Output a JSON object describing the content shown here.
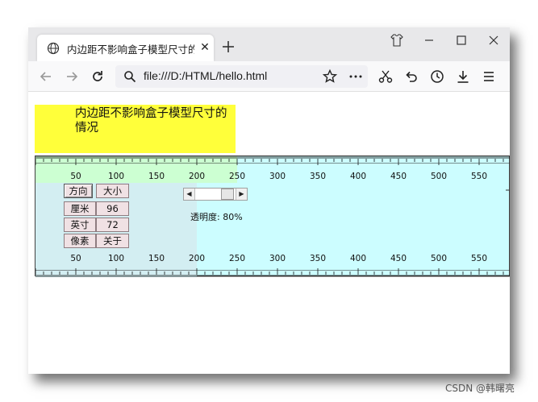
{
  "browser": {
    "tab_title": "内边距不影响盒子模型尺寸的",
    "tab_close_glyph": "✕",
    "address": "file:///D:/HTML/hello.html",
    "icons": [
      "globe-icon",
      "new-tab-plus-icon",
      "shirt-theme-icon",
      "minimize-icon",
      "maximize-icon",
      "close-window-icon",
      "back-arrow-icon",
      "forward-arrow-icon",
      "reload-icon",
      "search-icon",
      "bookmark-star-icon",
      "more-dots-icon",
      "cut-scissors-icon",
      "undo-icon",
      "history-clock-icon",
      "download-icon",
      "menu-icon"
    ]
  },
  "page": {
    "box_text": "内边距不影响盒子模型尺寸的情况",
    "box_color": "#ffff3a"
  },
  "ruler": {
    "background": "#ccfdff",
    "top_labels": [
      "50",
      "100",
      "150",
      "200",
      "250",
      "300",
      "350",
      "400",
      "450",
      "500",
      "550"
    ],
    "bottom_labels": [
      "50",
      "100",
      "150",
      "200",
      "250",
      "300",
      "350",
      "400",
      "450",
      "500",
      "550"
    ],
    "controls": {
      "direction": "方向",
      "size": "大小",
      "cm_label": "厘米",
      "cm_value": "96",
      "inch_label": "英寸",
      "inch_value": "72",
      "pixel_label": "像素",
      "about": "关于"
    },
    "opacity_label": "透明度: 80%",
    "opacity_fraction": 0.8
  },
  "watermark": "CSDN @韩曙亮"
}
